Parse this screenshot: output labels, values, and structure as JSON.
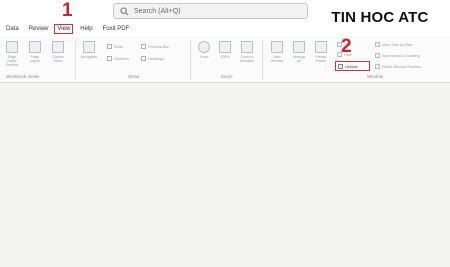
{
  "brand": {
    "text": "TIN HOC ATC"
  },
  "search": {
    "placeholder": "Search (Alt+Q)"
  },
  "menu": [
    "Data",
    "Review",
    "View",
    "Help",
    "Foxit PDF"
  ],
  "steps": {
    "one": "1",
    "two": "2"
  },
  "groups": {
    "workbook_views": "Workbook Views",
    "show": "Show",
    "zoom": "Zoom",
    "window": "Window"
  },
  "buttons": {
    "page_break": "Page Break\nPreview",
    "page_layout": "Page\nLayout",
    "custom_views": "Custom\nViews",
    "navigation": "Navigation",
    "ruler": "Ruler",
    "gridlines": "Gridlines",
    "formula_bar": "Formula Bar",
    "headings": "Headings",
    "zoom": "Zoom",
    "zoom_100": "100%",
    "zoom_selection": "Zoom to\nSelection",
    "new_window": "New\nWindow",
    "arrange_all": "Arrange\nAll",
    "freeze_panes": "Freeze\nPanes",
    "split": "Split",
    "hide": "Hide",
    "unhide": "Unhide",
    "view_side": "View Side by Side",
    "sync_scroll": "Synchronous Scrolling",
    "reset_pos": "Reset Window Position"
  }
}
